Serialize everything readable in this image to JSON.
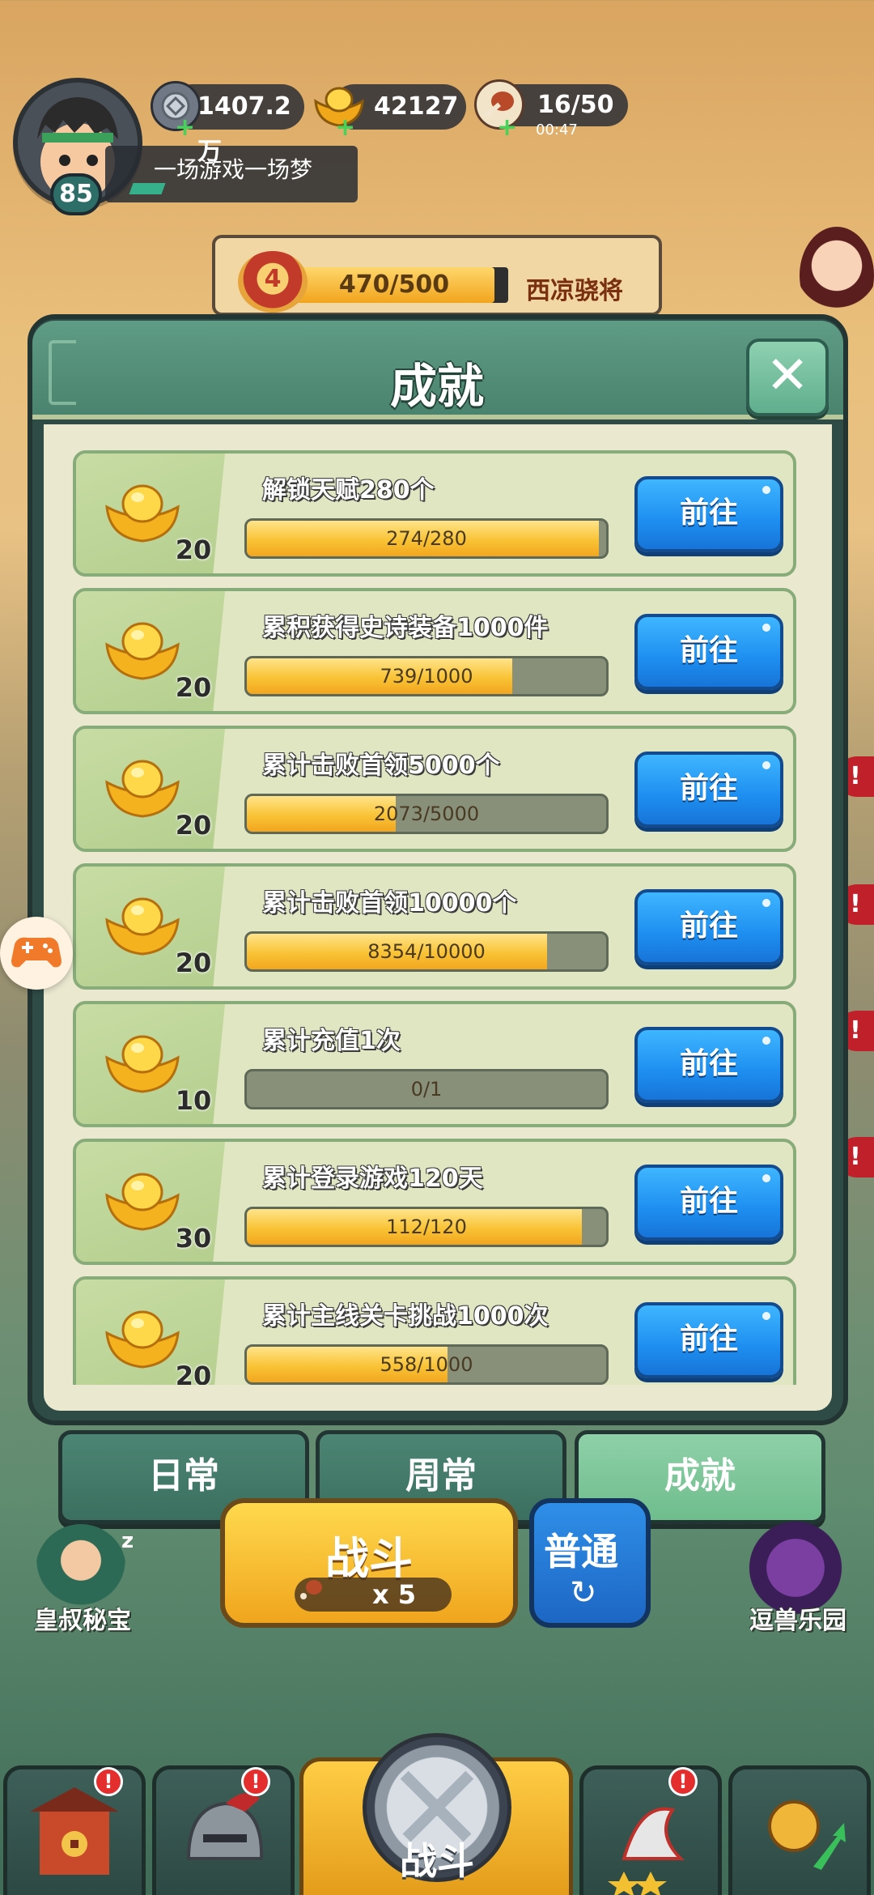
{
  "player": {
    "level": "85",
    "name": "一场游戏一场梦"
  },
  "resources": {
    "silver": "1407.2万",
    "gold": "42127",
    "stamina": "16/50",
    "stamina_timer": "00:47",
    "plus": "+"
  },
  "rank": {
    "level": "4",
    "progress_text": "470/500",
    "progress": 0.94,
    "title": "西凉骁将"
  },
  "modal": {
    "title": "成就",
    "close_symbol": "✕",
    "go_label": "前往",
    "items": [
      {
        "title": "解锁天赋280个",
        "reward": "20",
        "progress_text": "274/280",
        "progress": 0.979
      },
      {
        "title": "累积获得史诗装备1000件",
        "reward": "20",
        "progress_text": "739/1000",
        "progress": 0.739
      },
      {
        "title": "累计击败首领5000个",
        "reward": "20",
        "progress_text": "2073/5000",
        "progress": 0.415
      },
      {
        "title": "累计击败首领10000个",
        "reward": "20",
        "progress_text": "8354/10000",
        "progress": 0.835
      },
      {
        "title": "累计充值1次",
        "reward": "10",
        "progress_text": "0/1",
        "progress": 0
      },
      {
        "title": "累计登录游戏120天",
        "reward": "30",
        "progress_text": "112/120",
        "progress": 0.933
      },
      {
        "title": "累计主线关卡挑战1000次",
        "reward": "20",
        "progress_text": "558/1000",
        "progress": 0.558
      }
    ]
  },
  "tabs": [
    {
      "label": "日常",
      "active": false
    },
    {
      "label": "周常",
      "active": false
    },
    {
      "label": "成就",
      "active": true
    }
  ],
  "game": {
    "battle_label": "战斗",
    "battle_cost": "x 5",
    "mode_label": "普通",
    "mode_icon": "↻",
    "left_feature": "皇叔秘宝",
    "right_feature": "逗兽乐园",
    "sleep_mark": "z",
    "nav_battle_label": "战斗",
    "alert_mark": "!"
  },
  "colors": {
    "accent_green": "#4a836e",
    "go_button_blue": "#1d8ef0",
    "progress_gold": "#f9c335",
    "alert_red": "#e42e2e"
  }
}
